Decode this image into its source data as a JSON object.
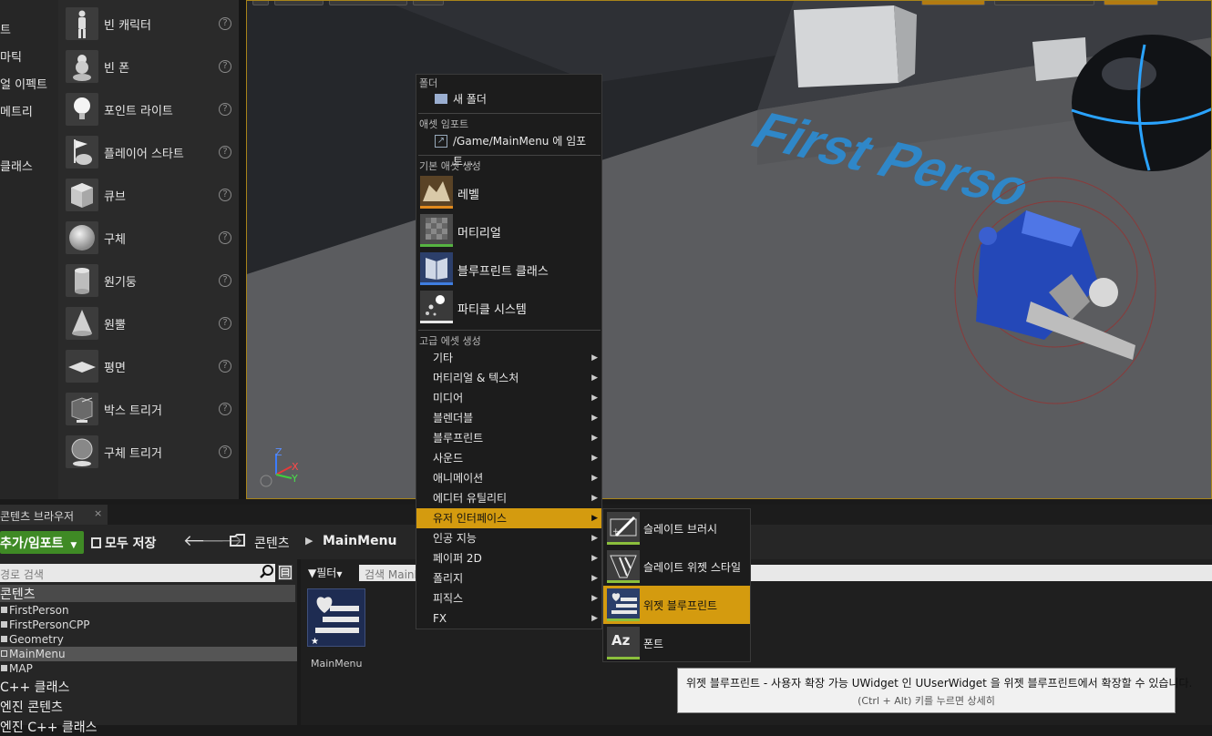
{
  "left_categories": [
    "트",
    "마틱",
    "얼 이펙트",
    "메트리",
    "클래스"
  ],
  "actors": [
    {
      "label": "빈 캐릭터",
      "icon": "empty-character-icon"
    },
    {
      "label": "빈 폰",
      "icon": "empty-pawn-icon"
    },
    {
      "label": "포인트 라이트",
      "icon": "point-light-icon"
    },
    {
      "label": "플레이어 스타트",
      "icon": "player-start-icon"
    },
    {
      "label": "큐브",
      "icon": "cube-icon"
    },
    {
      "label": "구체",
      "icon": "sphere-icon"
    },
    {
      "label": "원기둥",
      "icon": "cylinder-icon"
    },
    {
      "label": "원뿔",
      "icon": "cone-icon"
    },
    {
      "label": "평면",
      "icon": "plane-icon"
    },
    {
      "label": "박스 트리거",
      "icon": "box-trigger-icon"
    },
    {
      "label": "구체 트리거",
      "icon": "sphere-trigger-icon"
    }
  ],
  "help_glyph": "?",
  "viewport": {
    "floor_text": "First Perso",
    "axis": {
      "z": "Z",
      "x": "X",
      "y": "Y"
    }
  },
  "content_browser": {
    "tab_label": "콘텐츠 브라우저",
    "tab_close": "×",
    "add_import": "추가/임포트",
    "save_all": "모두 저장",
    "breadcrumb": {
      "root": "콘텐츠",
      "sep": "▶",
      "current": "MainMenu"
    },
    "path_search_placeholder": "경로 검색",
    "filter_label": "필터",
    "asset_search_placeholder": "검색 MainMenu",
    "tree": {
      "root": "콘텐츠",
      "folders": [
        "FirstPerson",
        "FirstPersonCPP",
        "Geometry",
        "MainMenu",
        "MAP"
      ],
      "cpp_classes": "C++ 클래스",
      "engine_content": "엔진 콘텐츠",
      "engine_cpp": "엔진 C++ 클래스"
    },
    "asset": {
      "name": "MainMenu"
    }
  },
  "context_menu": {
    "folder_header": "폴더",
    "new_folder": "새 폴더",
    "import_header": "애셋 임포트",
    "import_item": "/Game/MainMenu 에 임포트...",
    "basic_header": "기본 애셋 생성",
    "basic_items": [
      {
        "label": "레벨",
        "icon": "level-icon",
        "color": "#e08a1e"
      },
      {
        "label": "머티리얼",
        "icon": "material-icon",
        "color": "#56b342"
      },
      {
        "label": "블루프린트 클래스",
        "icon": "blueprint-class-icon",
        "color": "#3f7de0"
      },
      {
        "label": "파티클 시스템",
        "icon": "particle-system-icon",
        "color": "#e6e6e6"
      }
    ],
    "advanced_header": "고급 에셋 생성",
    "advanced_items": [
      "기타",
      "머티리얼 & 텍스처",
      "미디어",
      "블렌더블",
      "블루프린트",
      "사운드",
      "애니메이션",
      "에디터 유틸리티",
      "유저 인터페이스",
      "인공 지능",
      "페이퍼 2D",
      "폴리지",
      "피직스",
      "FX"
    ],
    "active_item": "유저 인터페이스",
    "accent": "#d49b0f"
  },
  "submenu": {
    "items": [
      {
        "label": "슬레이트 브러시",
        "icon": "slate-brush-icon"
      },
      {
        "label": "슬레이트 위젯 스타일",
        "icon": "slate-widget-style-icon"
      },
      {
        "label": "위젯 블루프린트",
        "icon": "widget-blueprint-icon"
      },
      {
        "label": "폰트",
        "icon": "font-icon"
      }
    ],
    "active_item": "위젯 블루프린트",
    "font_glyph": "Az"
  },
  "tooltip": {
    "main": "위젯 블루프린트 - 사용자 확장 가능 UWidget 인 UUserWidget 을 위젯 블루프린트에서 확장할 수 있습니다.",
    "hint": "(Ctrl + Alt) 키를 누르면 상세히"
  }
}
